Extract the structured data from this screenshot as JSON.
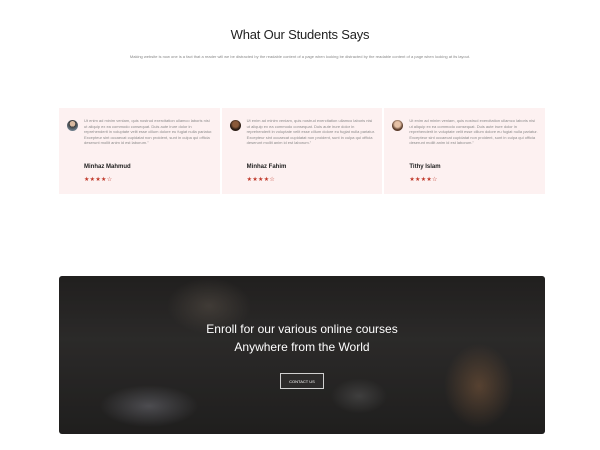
{
  "section": {
    "title": "What Our Students Says",
    "subtitle": "Making website is now one is a fact that a reader will we be distracted by the readable content of a page when looking be distracted by the readable content of a page when looking at its layout."
  },
  "testimonials": [
    {
      "avatar_icon": "user-avatar-icon",
      "quote": "Ut enim ad minim veniam, quis nostrud exercitation ullamco laboris nisi ut aliquip ex ea commodo consequat. Duis aute irure dolor in reprehenderit in voluptate velit esse cillum dolore eu fugiat nulla pariatur. Excepteur sint occaecat cupidatat non proident, sunt in culpa qui officia deserunt mollit anim id est laborum.\"",
      "name": "Minhaz Mahmud",
      "stars": "★★★★☆",
      "rating": 4
    },
    {
      "avatar_icon": "user-avatar-icon",
      "quote": "Ut enim ad minim veniam, quis nostrud exercitation ullamco laboris nisi ut aliquip ex ea commodo consequat. Duis aute irure dolor in reprehenderit in voluptate velit esse cillum dolore eu fugiat nulla pariatur. Excepteur sint occaecat cupidatat non proident, sunt in culpa qui officia deserunt mollit anim id est laborum.\"",
      "name": "Minhaz Fahim",
      "stars": "★★★★☆",
      "rating": 4
    },
    {
      "avatar_icon": "user-avatar-icon",
      "quote": "Ut enim ad minim veniam, quis nostrud exercitation ullamco laboris nisi ut aliquip ex ea commodo consequat. Duis aute irure dolor in reprehenderit in voluptate velit esse cillum dolore eu fugiat nulla pariatur. Excepteur sint occaecat cupidatat non proident, sunt in culpa qui officia deserunt mollit anim id est laborum.\"",
      "name": "Tithy Islam",
      "stars": "★★★★☆",
      "rating": 4
    }
  ],
  "banner": {
    "line1": "Enroll for our various online courses",
    "line2": "Anywhere from the World",
    "button_label": "CONTACT US"
  },
  "colors": {
    "card_bg": "#fdf1f1",
    "star": "#c0392b"
  }
}
